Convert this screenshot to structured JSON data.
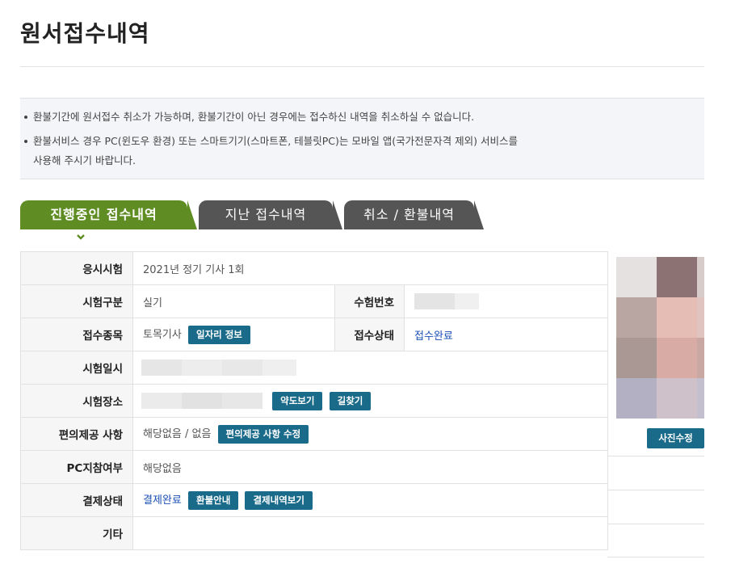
{
  "page": {
    "title": "원서접수내역"
  },
  "notice": {
    "line1": "환불기간에 원서접수 취소가 가능하며, 환불기간이 아닌 경우에는 접수하신 내역을 취소하실 수 없습니다.",
    "line2a": "환불서비스 경우 PC(윈도우 환경) 또는 스마트기기(스마트폰, 테블릿PC)는 모바일 앱(국가전문자격 제외) 서비스를",
    "line2b": "사용해 주시기 바랍니다."
  },
  "tabs": [
    {
      "label": "진행중인 접수내역",
      "active": true
    },
    {
      "label": "지난 접수내역",
      "active": false
    },
    {
      "label": "취소 / 환불내역",
      "active": false
    }
  ],
  "rows": {
    "exam": {
      "label": "응시시험",
      "value": "2021년 정기 기사 1회"
    },
    "category": {
      "label": "시험구분",
      "value": "실기"
    },
    "exam_number": {
      "label": "수험번호"
    },
    "field": {
      "label": "접수종목",
      "value": "토목기사",
      "button": "일자리 정보"
    },
    "status": {
      "label": "접수상태",
      "value": "접수완료"
    },
    "date": {
      "label": "시험일시"
    },
    "place": {
      "label": "시험장소",
      "button_map": "약도보기",
      "button_route": "길찾기"
    },
    "convenience": {
      "label": "편의제공 사항",
      "value": "해당없음 / 없음",
      "button": "편의제공 사항 수정"
    },
    "pc": {
      "label": "PC지참여부",
      "value": "해당없음"
    },
    "payment": {
      "label": "결제상태",
      "value": "결제완료",
      "button_refund": "환불안내",
      "button_history": "결제내역보기"
    },
    "etc": {
      "label": "기타",
      "value": ""
    }
  },
  "photo": {
    "button": "사진수정"
  },
  "colors": {
    "active_tab": "#5f8d24",
    "inactive_tab": "#555555",
    "button": "#1a6a8a",
    "link": "#1a4fb5"
  }
}
